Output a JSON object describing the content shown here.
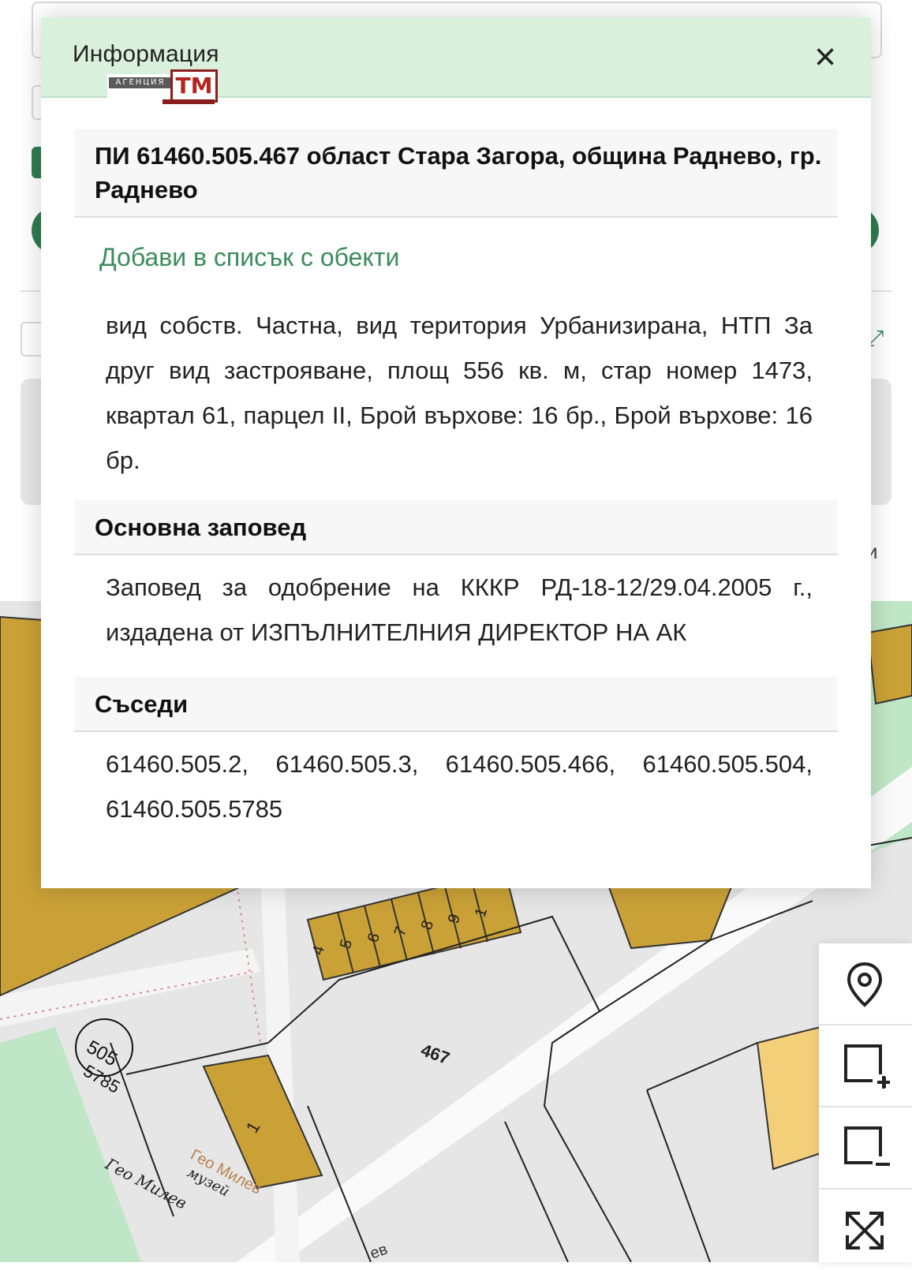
{
  "modal": {
    "title": "Информация",
    "logo_band": "АГЕНЦИЯ",
    "logo_box": "ТМ",
    "close_glyph": "×",
    "property_heading": "ПИ 61460.505.467 област Стара Загора, община Раднево, гр. Раднево",
    "add_link": "Добави в списък с обекти",
    "description": "вид собств. Частна, вид територия Урбанизирана, НТП За друг вид застрояване, площ 556 кв. м, стар номер 1473, квартал 61, парцел II, Брой върхове: 16 бр., Брой върхове: 16 бр.",
    "order_heading": "Основна заповед",
    "order_text": "Заповед за одобрение на КККР РД-18-12/29.04.2005 г., издадена от ИЗПЪЛНИТЕЛНИЯ ДИРЕКТОР НА АК",
    "neighbors_heading": "Съседи",
    "neighbors_text": "61460.505.2, 61460.505.3, 61460.505.466, 61460.505.504, 61460.505.5785"
  },
  "map": {
    "parcel_label": "467",
    "building_numbers": [
      "4",
      "5",
      "6",
      "7",
      "8",
      "9",
      "1"
    ],
    "building_1": "1",
    "circle_label": "505",
    "circle_sub": "5785",
    "street_label": "Гео Милев",
    "museum_label": "музей",
    "museum_name": "Гео Милев",
    "street_fragment_top": "ев",
    "street_fragment_bottom": "ев"
  },
  "toolbar": {
    "items": [
      "location-pin-icon",
      "add-area-icon",
      "remove-area-icon",
      "fullscreen-icon"
    ]
  },
  "colors": {
    "header_bg": "#d9f1dc",
    "link_green": "#3a8c5c",
    "building_fill": "#c9a137",
    "green_area": "#bfe6c6"
  }
}
